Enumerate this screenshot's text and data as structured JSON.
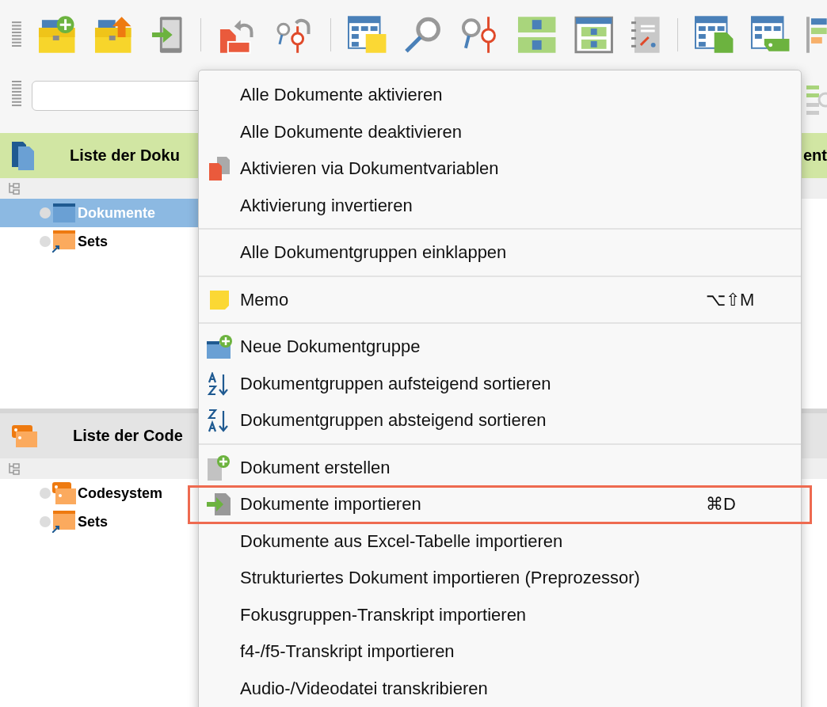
{
  "documents_panel": {
    "title": "Liste der Doku",
    "right_title": "ent",
    "items": [
      {
        "label": "Dokumente",
        "kind": "folder",
        "selected": true
      },
      {
        "label": "Sets",
        "kind": "sets",
        "selected": false
      }
    ]
  },
  "codes_panel": {
    "title": "Liste der Code",
    "items": [
      {
        "label": "Codesystem",
        "kind": "codes",
        "selected": false
      },
      {
        "label": "Sets",
        "kind": "sets",
        "selected": false
      }
    ]
  },
  "menu": {
    "groups": [
      {
        "items": [
          {
            "label": "Alle Dokumente aktivieren",
            "highlighted": false
          },
          {
            "label": "Alle Dokumente deaktivieren",
            "highlighted": false
          },
          {
            "label": "Aktivieren via Dokumentvariablen",
            "highlighted": false
          },
          {
            "label": "Aktivierung invertieren",
            "highlighted": false
          }
        ]
      },
      {
        "items": [
          {
            "label": "Alle Dokumentgruppen einklappen",
            "highlighted": false
          }
        ]
      },
      {
        "items": [
          {
            "label": "Memo",
            "shortcut": "⌥⇧M",
            "highlighted": false
          }
        ]
      },
      {
        "items": [
          {
            "label": "Neue Dokumentgruppe",
            "highlighted": false
          },
          {
            "label": "Dokumentgruppen aufsteigend sortieren",
            "highlighted": false
          },
          {
            "label": "Dokumentgruppen absteigend sortieren",
            "highlighted": false
          }
        ]
      },
      {
        "items": [
          {
            "label": "Dokument erstellen",
            "highlighted": false
          },
          {
            "label": "Dokumente importieren",
            "shortcut": "⌘D",
            "highlighted": true
          },
          {
            "label": "Dokumente aus Excel-Tabelle importieren",
            "highlighted": false
          },
          {
            "label": "Strukturiertes Dokument importieren (Preprozessor)",
            "highlighted": false
          },
          {
            "label": "Fokusgruppen-Transkript importieren",
            "highlighted": false
          },
          {
            "label": "f4-/f5-Transkript importieren",
            "highlighted": false
          },
          {
            "label": "Audio-/Videodatei transkribieren",
            "highlighted": false
          }
        ]
      }
    ]
  }
}
